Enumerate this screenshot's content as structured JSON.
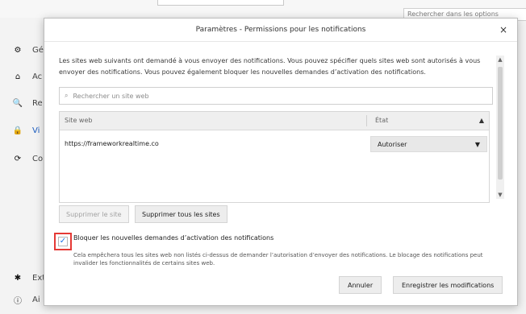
{
  "background": {
    "search_placeholder": "Rechercher dans les options",
    "sidebar": [
      {
        "icon": "gear-icon",
        "glyph": "⚙",
        "label": "Gé"
      },
      {
        "icon": "home-icon",
        "glyph": "⌂",
        "label": "Ac"
      },
      {
        "icon": "search-icon",
        "glyph": "🔍",
        "label": "Re"
      },
      {
        "icon": "lock-icon",
        "glyph": "🔒",
        "label": "Vi"
      },
      {
        "icon": "sync-icon",
        "glyph": "⟳",
        "label": "Co"
      }
    ],
    "bottom_items": [
      {
        "icon": "extension-icon",
        "glyph": "✱",
        "label": "Ext"
      },
      {
        "icon": "help-icon",
        "glyph": "ⓘ",
        "label": "Ai"
      }
    ]
  },
  "dialog": {
    "title": "Paramètres - Permissions pour les notifications",
    "close_glyph": "×",
    "description": "Les sites web suivants ont demandé à vous envoyer des notifications. Vous pouvez spécifier quels sites web sont autorisés à vous envoyer des notifications. Vous pouvez également bloquer les nouvelles demandes d’activation des notifications.",
    "search_placeholder": "Rechercher un site web",
    "table": {
      "col_site": "Site web",
      "col_state": "État",
      "rows": [
        {
          "site": "https://frameworkrealtime.co",
          "state": "Autoriser"
        }
      ]
    },
    "buttons": {
      "remove_site": "Supprimer le site",
      "remove_all": "Supprimer tous les sites",
      "cancel": "Annuler",
      "save": "Enregistrer les modifications"
    },
    "checkbox": {
      "checked": true,
      "label": "Bloquer les nouvelles demandes d’activation des notifications",
      "help": "Cela empêchera tous les sites web non listés ci-dessus de demander l’autorisation d’envoyer des notifications. Le blocage des notifications peut invalider les fonctionnalités de certains sites web."
    }
  }
}
